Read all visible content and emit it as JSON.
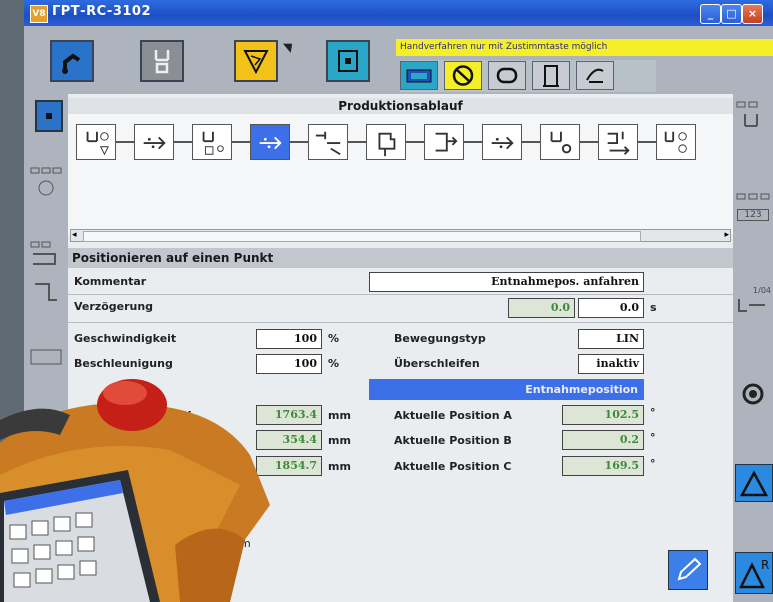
{
  "window": {
    "logo_text": "V8",
    "title": "ГРТ-RC-3102",
    "minimize": "_",
    "maximize": "□",
    "close": "×"
  },
  "toolbar": {
    "warning": "Handverfahren nur mit Zustimmtaste möglich"
  },
  "flow": {
    "title": "Produktionsablauf",
    "steps": [
      "gripper-open-icon",
      "move-icon",
      "gripper-close-icon",
      "move-active-icon",
      "tool-change-icon",
      "place-icon",
      "transfer-icon",
      "move-icon",
      "gripper-sense-icon",
      "sequence-icon",
      "gripper-check-icon"
    ]
  },
  "detail": {
    "title": "Positionieren auf einen Punkt",
    "kommentar_label": "Kommentar",
    "kommentar_value": "Entnahmepos. anfahren",
    "verzoegerung_label": "Verzögerung",
    "verzoegerung_actual": "0.0",
    "verzoegerung_value": "0.0",
    "verzoegerung_unit": "s",
    "geschwindigkeit_label": "Geschwindigkeit",
    "geschwindigkeit_value": "100",
    "geschwindigkeit_unit": "%",
    "beschleunigung_label": "Beschleunigung",
    "beschleunigung_value": "100",
    "beschleunigung_unit": "%",
    "bewegungstyp_label": "Bewegungstyp",
    "bewegungstyp_value": "LIN",
    "ueberschleifen_label": "Überschleifen",
    "ueberschleifen_value": "inaktiv",
    "position_name": "Entnahmeposition",
    "pos_x_label_tail": "X",
    "pos_x_value": "1763.4",
    "pos_y_value": "354.4",
    "pos_z_value": "1854.7",
    "mm_unit": "mm",
    "pos_a_label": "Aktuelle Position A",
    "pos_a_value": "102.5",
    "pos_b_label": "Aktuelle Position B",
    "pos_b_value": "0.2",
    "pos_c_label": "Aktuelle Position C",
    "pos_c_value": "169.5",
    "deg_unit": "°",
    "footer_tail": "m"
  },
  "side": {
    "right_counter": "123",
    "right_item_label": "1/04"
  },
  "colors": {
    "title_bar": "#1d4fc3",
    "accent_blue": "#3d6fe8",
    "warning_yellow": "#f5ef2a",
    "value_green": "#3d8a3a"
  }
}
